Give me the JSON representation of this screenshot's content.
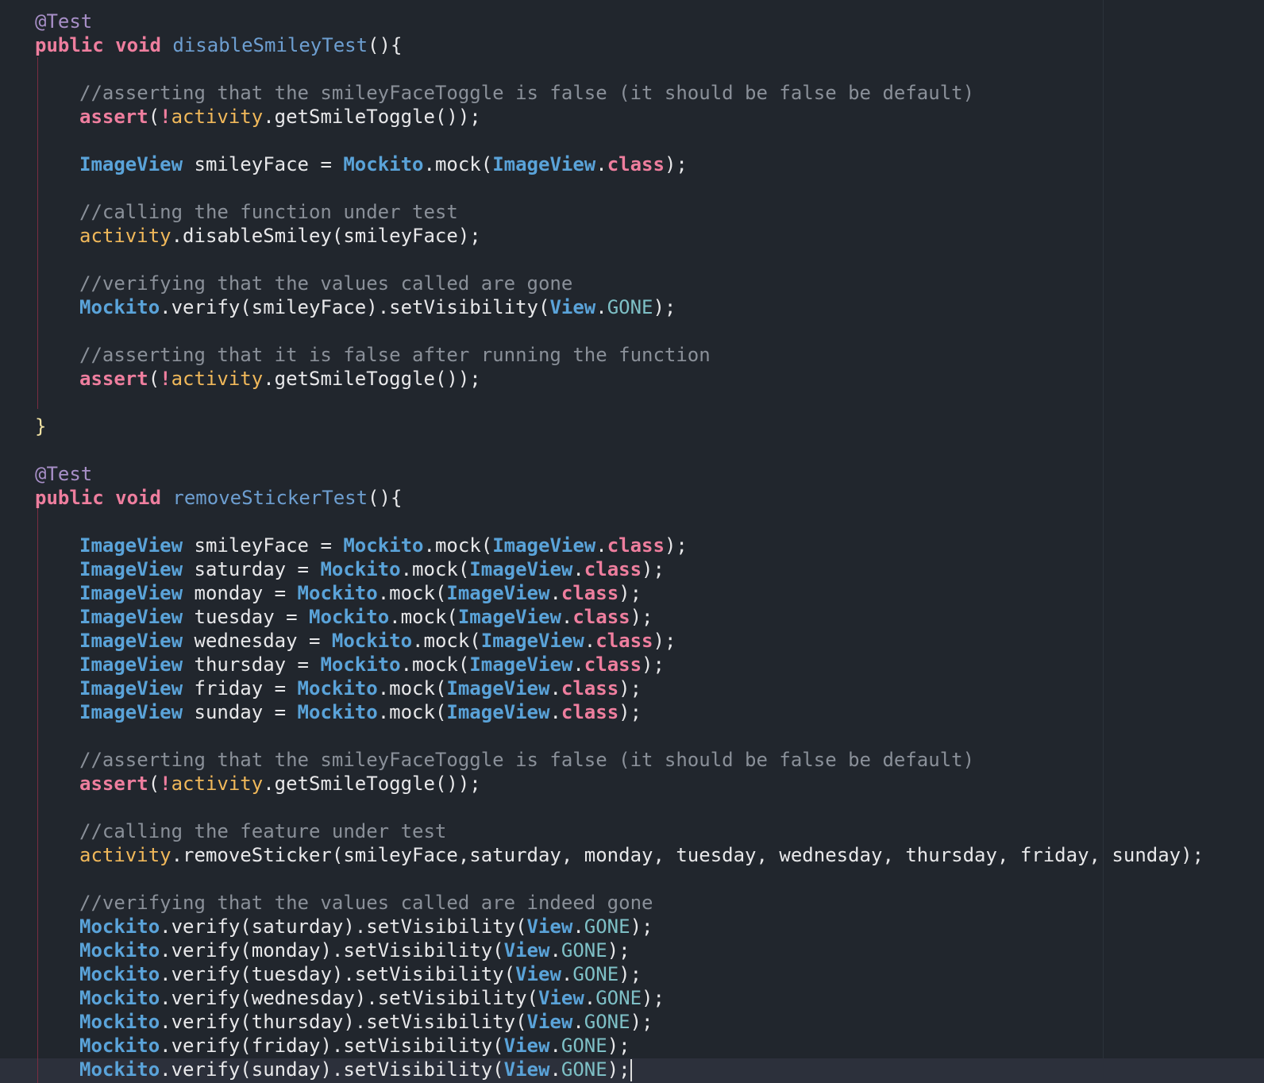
{
  "editor": {
    "language": "java",
    "theme_colors": {
      "background": "#21262d",
      "keyword": "#ee7e9e",
      "annotation": "#a88fc8",
      "method_name": "#6d9ed0",
      "type": "#5aa3d9",
      "comment": "#8a9099",
      "field": "#f0b85a",
      "constant": "#7ec0c6",
      "brace": "#f2e3a4",
      "plain": "#e8e8ea"
    },
    "lines": [
      {
        "indent": 0,
        "tokens": [
          [
            "annot",
            "@Test"
          ]
        ]
      },
      {
        "indent": 0,
        "tokens": [
          [
            "kw",
            "public"
          ],
          [
            "plain",
            " "
          ],
          [
            "kw",
            "void"
          ],
          [
            "plain",
            " "
          ],
          [
            "fn",
            "disableSmileyTest"
          ],
          [
            "plain",
            "(){"
          ]
        ]
      },
      {
        "indent": 0,
        "tokens": []
      },
      {
        "indent": 1,
        "tokens": [
          [
            "comment",
            "//asserting that the smileyFaceToggle is false (it should be false be default)"
          ]
        ]
      },
      {
        "indent": 1,
        "tokens": [
          [
            "kw",
            "assert"
          ],
          [
            "plain",
            "("
          ],
          [
            "kw",
            "!"
          ],
          [
            "field",
            "activity"
          ],
          [
            "plain",
            ".getSmileToggle());"
          ]
        ]
      },
      {
        "indent": 1,
        "tokens": []
      },
      {
        "indent": 1,
        "tokens": [
          [
            "type",
            "ImageView"
          ],
          [
            "plain",
            " smileyFace = "
          ],
          [
            "type",
            "Mockito"
          ],
          [
            "plain",
            ".mock("
          ],
          [
            "type",
            "ImageView"
          ],
          [
            "plain",
            "."
          ],
          [
            "kw",
            "class"
          ],
          [
            "plain",
            ");"
          ]
        ]
      },
      {
        "indent": 1,
        "tokens": []
      },
      {
        "indent": 1,
        "tokens": [
          [
            "comment",
            "//calling the function under test"
          ]
        ]
      },
      {
        "indent": 1,
        "tokens": [
          [
            "field",
            "activity"
          ],
          [
            "plain",
            ".disableSmiley(smileyFace);"
          ]
        ]
      },
      {
        "indent": 1,
        "tokens": []
      },
      {
        "indent": 1,
        "tokens": [
          [
            "comment",
            "//verifying that the values called are gone"
          ]
        ]
      },
      {
        "indent": 1,
        "tokens": [
          [
            "type",
            "Mockito"
          ],
          [
            "plain",
            ".verify(smileyFace).setVisibility("
          ],
          [
            "type",
            "View"
          ],
          [
            "plain",
            "."
          ],
          [
            "const",
            "GONE"
          ],
          [
            "plain",
            ");"
          ]
        ]
      },
      {
        "indent": 1,
        "tokens": []
      },
      {
        "indent": 1,
        "tokens": [
          [
            "comment",
            "//asserting that it is false after running the function"
          ]
        ]
      },
      {
        "indent": 1,
        "tokens": [
          [
            "kw",
            "assert"
          ],
          [
            "plain",
            "("
          ],
          [
            "kw",
            "!"
          ],
          [
            "field",
            "activity"
          ],
          [
            "plain",
            ".getSmileToggle());"
          ]
        ]
      },
      {
        "indent": 1,
        "tokens": []
      },
      {
        "indent": 0,
        "tokens": [
          [
            "brace",
            "}"
          ]
        ]
      },
      {
        "indent": 0,
        "tokens": []
      },
      {
        "indent": 0,
        "tokens": [
          [
            "annot",
            "@Test"
          ]
        ]
      },
      {
        "indent": 0,
        "tokens": [
          [
            "kw",
            "public"
          ],
          [
            "plain",
            " "
          ],
          [
            "kw",
            "void"
          ],
          [
            "plain",
            " "
          ],
          [
            "fn",
            "removeStickerTest"
          ],
          [
            "plain",
            "(){"
          ]
        ]
      },
      {
        "indent": 0,
        "tokens": []
      },
      {
        "indent": 1,
        "tokens": [
          [
            "type",
            "ImageView"
          ],
          [
            "plain",
            " smileyFace = "
          ],
          [
            "type",
            "Mockito"
          ],
          [
            "plain",
            ".mock("
          ],
          [
            "type",
            "ImageView"
          ],
          [
            "plain",
            "."
          ],
          [
            "kw",
            "class"
          ],
          [
            "plain",
            ");"
          ]
        ]
      },
      {
        "indent": 1,
        "tokens": [
          [
            "type",
            "ImageView"
          ],
          [
            "plain",
            " saturday = "
          ],
          [
            "type",
            "Mockito"
          ],
          [
            "plain",
            ".mock("
          ],
          [
            "type",
            "ImageView"
          ],
          [
            "plain",
            "."
          ],
          [
            "kw",
            "class"
          ],
          [
            "plain",
            ");"
          ]
        ]
      },
      {
        "indent": 1,
        "tokens": [
          [
            "type",
            "ImageView"
          ],
          [
            "plain",
            " monday = "
          ],
          [
            "type",
            "Mockito"
          ],
          [
            "plain",
            ".mock("
          ],
          [
            "type",
            "ImageView"
          ],
          [
            "plain",
            "."
          ],
          [
            "kw",
            "class"
          ],
          [
            "plain",
            ");"
          ]
        ]
      },
      {
        "indent": 1,
        "tokens": [
          [
            "type",
            "ImageView"
          ],
          [
            "plain",
            " tuesday = "
          ],
          [
            "type",
            "Mockito"
          ],
          [
            "plain",
            ".mock("
          ],
          [
            "type",
            "ImageView"
          ],
          [
            "plain",
            "."
          ],
          [
            "kw",
            "class"
          ],
          [
            "plain",
            ");"
          ]
        ]
      },
      {
        "indent": 1,
        "tokens": [
          [
            "type",
            "ImageView"
          ],
          [
            "plain",
            " wednesday = "
          ],
          [
            "type",
            "Mockito"
          ],
          [
            "plain",
            ".mock("
          ],
          [
            "type",
            "ImageView"
          ],
          [
            "plain",
            "."
          ],
          [
            "kw",
            "class"
          ],
          [
            "plain",
            ");"
          ]
        ]
      },
      {
        "indent": 1,
        "tokens": [
          [
            "type",
            "ImageView"
          ],
          [
            "plain",
            " thursday = "
          ],
          [
            "type",
            "Mockito"
          ],
          [
            "plain",
            ".mock("
          ],
          [
            "type",
            "ImageView"
          ],
          [
            "plain",
            "."
          ],
          [
            "kw",
            "class"
          ],
          [
            "plain",
            ");"
          ]
        ]
      },
      {
        "indent": 1,
        "tokens": [
          [
            "type",
            "ImageView"
          ],
          [
            "plain",
            " friday = "
          ],
          [
            "type",
            "Mockito"
          ],
          [
            "plain",
            ".mock("
          ],
          [
            "type",
            "ImageView"
          ],
          [
            "plain",
            "."
          ],
          [
            "kw",
            "class"
          ],
          [
            "plain",
            ");"
          ]
        ]
      },
      {
        "indent": 1,
        "tokens": [
          [
            "type",
            "ImageView"
          ],
          [
            "plain",
            " sunday = "
          ],
          [
            "type",
            "Mockito"
          ],
          [
            "plain",
            ".mock("
          ],
          [
            "type",
            "ImageView"
          ],
          [
            "plain",
            "."
          ],
          [
            "kw",
            "class"
          ],
          [
            "plain",
            ");"
          ]
        ]
      },
      {
        "indent": 1,
        "tokens": []
      },
      {
        "indent": 1,
        "tokens": [
          [
            "comment",
            "//asserting that the smileyFaceToggle is false (it should be false be default)"
          ]
        ]
      },
      {
        "indent": 1,
        "tokens": [
          [
            "kw",
            "assert"
          ],
          [
            "plain",
            "("
          ],
          [
            "kw",
            "!"
          ],
          [
            "field",
            "activity"
          ],
          [
            "plain",
            ".getSmileToggle());"
          ]
        ]
      },
      {
        "indent": 1,
        "tokens": []
      },
      {
        "indent": 1,
        "tokens": [
          [
            "comment",
            "//calling the feature under test"
          ]
        ]
      },
      {
        "indent": 1,
        "tokens": [
          [
            "field",
            "activity"
          ],
          [
            "plain",
            ".removeSticker(smileyFace,saturday, monday, tuesday, wednesday, thursday, friday, sunday);"
          ]
        ]
      },
      {
        "indent": 1,
        "tokens": []
      },
      {
        "indent": 1,
        "tokens": [
          [
            "comment",
            "//verifying that the values called are indeed gone"
          ]
        ]
      },
      {
        "indent": 1,
        "tokens": [
          [
            "type",
            "Mockito"
          ],
          [
            "plain",
            ".verify(saturday).setVisibility("
          ],
          [
            "type",
            "View"
          ],
          [
            "plain",
            "."
          ],
          [
            "const",
            "GONE"
          ],
          [
            "plain",
            ");"
          ]
        ]
      },
      {
        "indent": 1,
        "tokens": [
          [
            "type",
            "Mockito"
          ],
          [
            "plain",
            ".verify(monday).setVisibility("
          ],
          [
            "type",
            "View"
          ],
          [
            "plain",
            "."
          ],
          [
            "const",
            "GONE"
          ],
          [
            "plain",
            ");"
          ]
        ]
      },
      {
        "indent": 1,
        "tokens": [
          [
            "type",
            "Mockito"
          ],
          [
            "plain",
            ".verify(tuesday).setVisibility("
          ],
          [
            "type",
            "View"
          ],
          [
            "plain",
            "."
          ],
          [
            "const",
            "GONE"
          ],
          [
            "plain",
            ");"
          ]
        ]
      },
      {
        "indent": 1,
        "tokens": [
          [
            "type",
            "Mockito"
          ],
          [
            "plain",
            ".verify(wednesday).setVisibility("
          ],
          [
            "type",
            "View"
          ],
          [
            "plain",
            "."
          ],
          [
            "const",
            "GONE"
          ],
          [
            "plain",
            ");"
          ]
        ]
      },
      {
        "indent": 1,
        "tokens": [
          [
            "type",
            "Mockito"
          ],
          [
            "plain",
            ".verify(thursday).setVisibility("
          ],
          [
            "type",
            "View"
          ],
          [
            "plain",
            "."
          ],
          [
            "const",
            "GONE"
          ],
          [
            "plain",
            ");"
          ]
        ]
      },
      {
        "indent": 1,
        "tokens": [
          [
            "type",
            "Mockito"
          ],
          [
            "plain",
            ".verify(friday).setVisibility("
          ],
          [
            "type",
            "View"
          ],
          [
            "plain",
            "."
          ],
          [
            "const",
            "GONE"
          ],
          [
            "plain",
            ");"
          ]
        ]
      },
      {
        "indent": 1,
        "tokens": [
          [
            "type",
            "Mockito"
          ],
          [
            "plain",
            ".verify(sunday).setVisibility("
          ],
          [
            "type",
            "View"
          ],
          [
            "plain",
            "."
          ],
          [
            "const",
            "GONE"
          ],
          [
            "plain",
            ");"
          ]
        ],
        "has_caret": true
      }
    ]
  }
}
